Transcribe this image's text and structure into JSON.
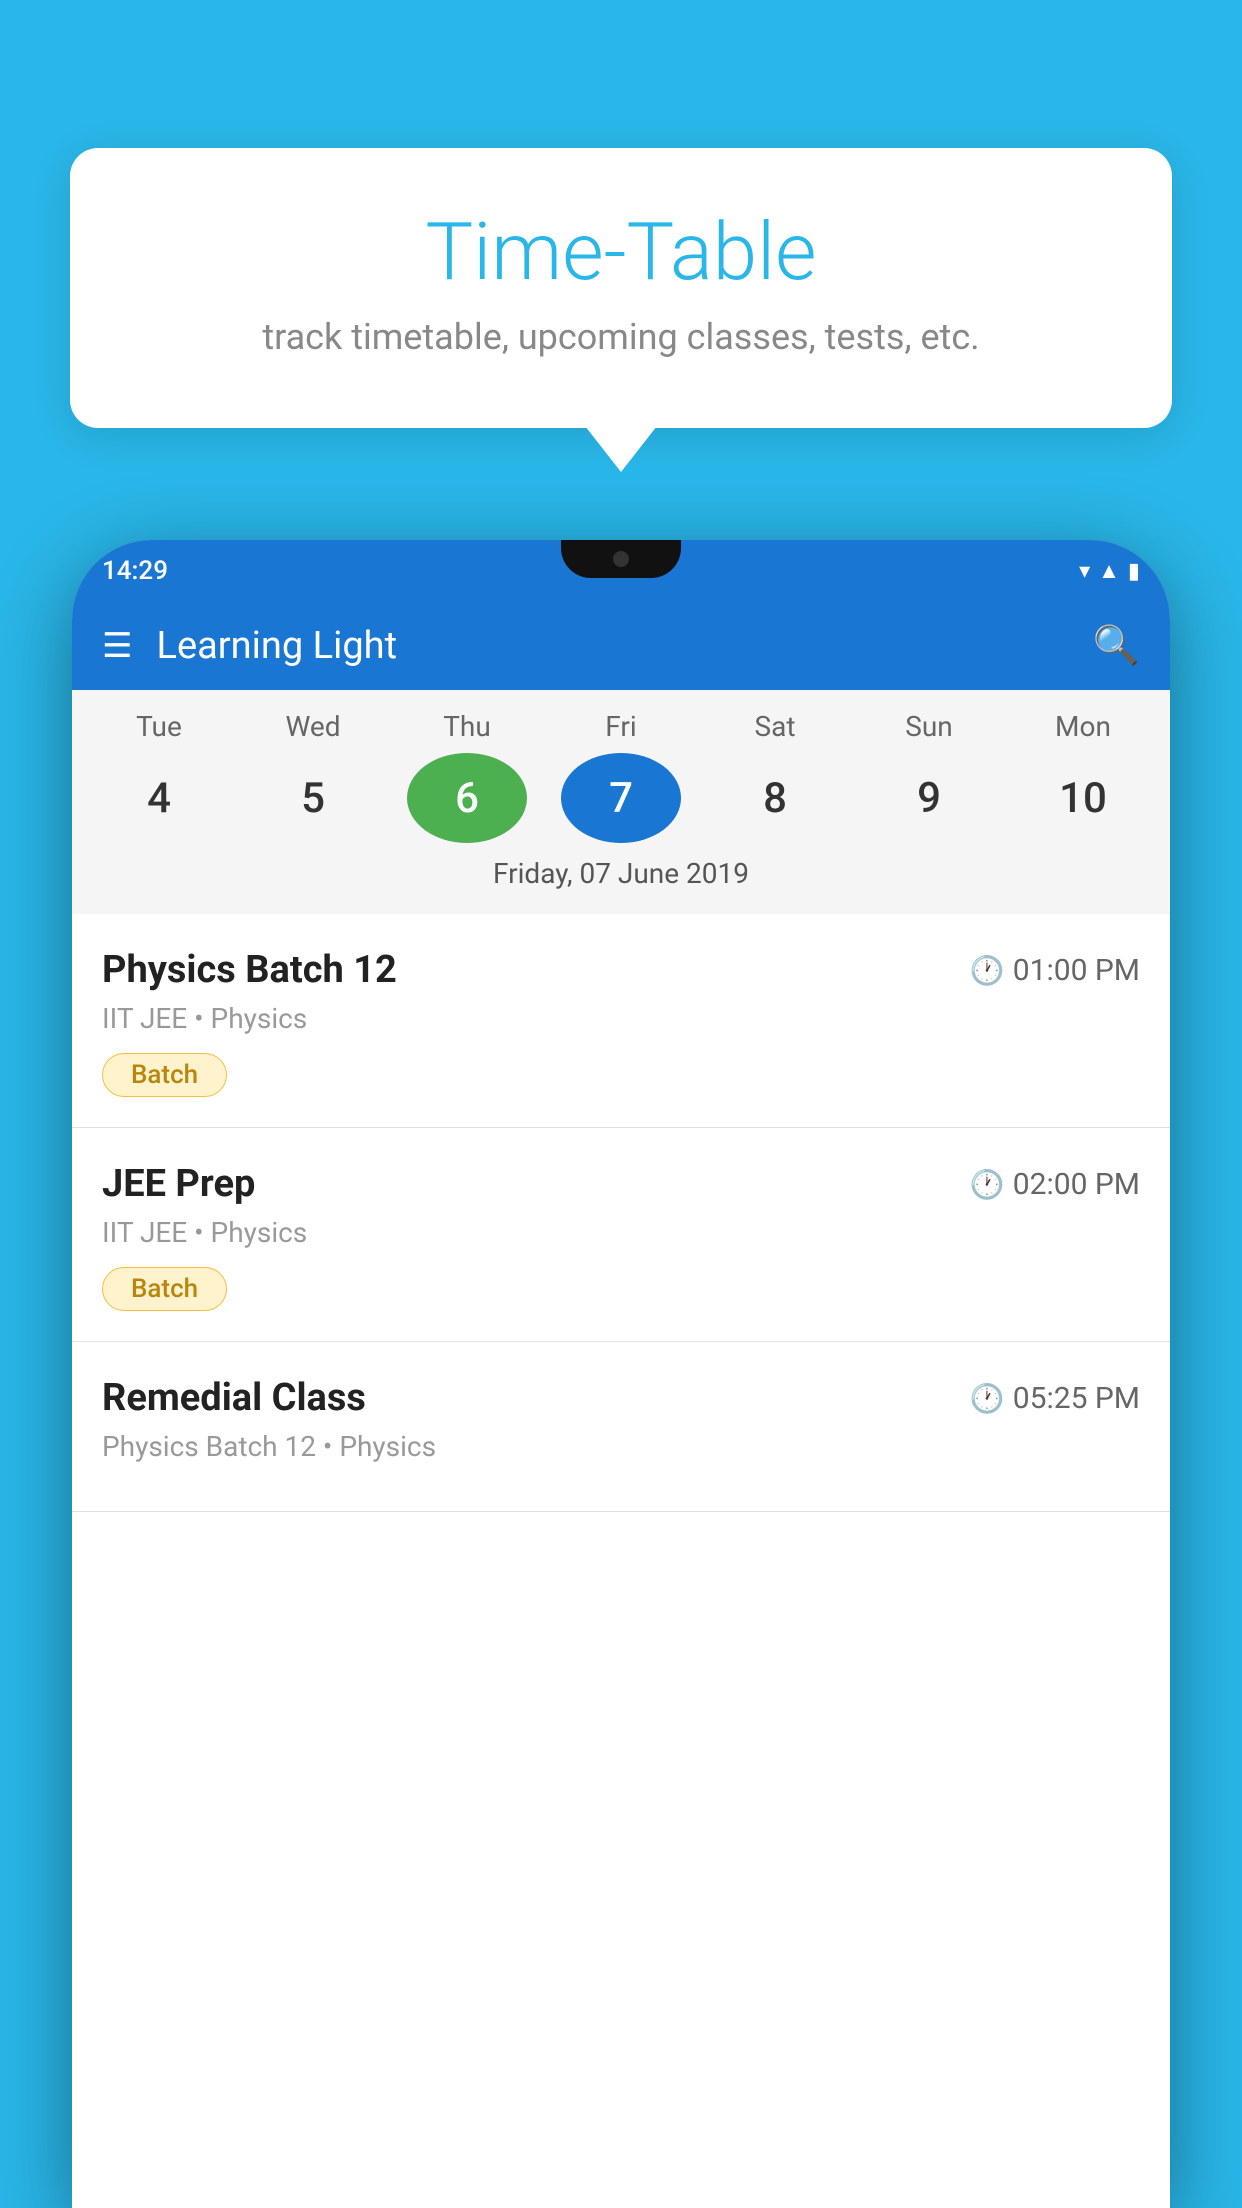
{
  "background_color": "#29b6e8",
  "tooltip": {
    "title": "Time-Table",
    "subtitle": "track timetable, upcoming classes, tests, etc."
  },
  "phone": {
    "status_bar": {
      "time": "14:29",
      "icons": [
        "wifi",
        "signal",
        "battery"
      ]
    },
    "toolbar": {
      "title": "Learning Light",
      "hamburger_label": "☰",
      "search_label": "🔍"
    },
    "calendar": {
      "days": [
        {
          "label": "Tue",
          "num": "4"
        },
        {
          "label": "Wed",
          "num": "5"
        },
        {
          "label": "Thu",
          "num": "6",
          "state": "today"
        },
        {
          "label": "Fri",
          "num": "7",
          "state": "selected"
        },
        {
          "label": "Sat",
          "num": "8"
        },
        {
          "label": "Sun",
          "num": "9"
        },
        {
          "label": "Mon",
          "num": "10"
        }
      ],
      "selected_date": "Friday, 07 June 2019"
    },
    "schedule": [
      {
        "title": "Physics Batch 12",
        "time": "01:00 PM",
        "subtitle": "IIT JEE • Physics",
        "badge": "Batch"
      },
      {
        "title": "JEE Prep",
        "time": "02:00 PM",
        "subtitle": "IIT JEE • Physics",
        "badge": "Batch"
      },
      {
        "title": "Remedial Class",
        "time": "05:25 PM",
        "subtitle": "Physics Batch 12 • Physics",
        "badge": null
      }
    ]
  }
}
